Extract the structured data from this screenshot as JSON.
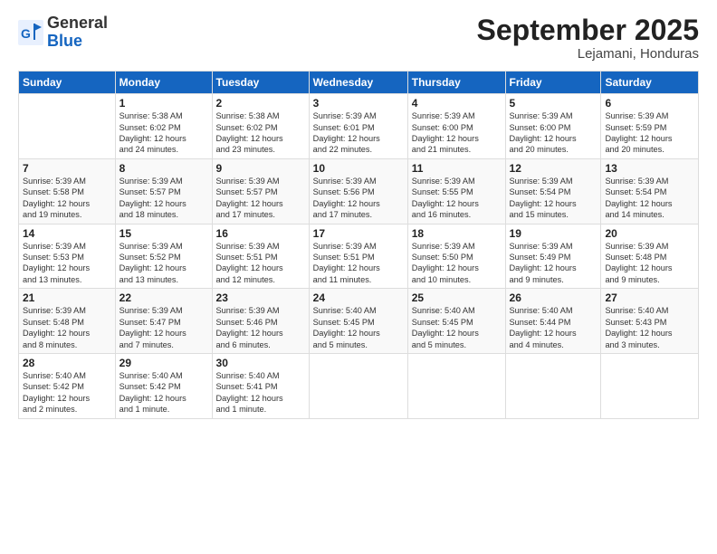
{
  "header": {
    "logo_general": "General",
    "logo_blue": "Blue",
    "month": "September 2025",
    "location": "Lejamani, Honduras"
  },
  "columns": [
    "Sunday",
    "Monday",
    "Tuesday",
    "Wednesday",
    "Thursday",
    "Friday",
    "Saturday"
  ],
  "weeks": [
    [
      {
        "day": "",
        "info": ""
      },
      {
        "day": "1",
        "info": "Sunrise: 5:38 AM\nSunset: 6:02 PM\nDaylight: 12 hours\nand 24 minutes."
      },
      {
        "day": "2",
        "info": "Sunrise: 5:38 AM\nSunset: 6:02 PM\nDaylight: 12 hours\nand 23 minutes."
      },
      {
        "day": "3",
        "info": "Sunrise: 5:39 AM\nSunset: 6:01 PM\nDaylight: 12 hours\nand 22 minutes."
      },
      {
        "day": "4",
        "info": "Sunrise: 5:39 AM\nSunset: 6:00 PM\nDaylight: 12 hours\nand 21 minutes."
      },
      {
        "day": "5",
        "info": "Sunrise: 5:39 AM\nSunset: 6:00 PM\nDaylight: 12 hours\nand 20 minutes."
      },
      {
        "day": "6",
        "info": "Sunrise: 5:39 AM\nSunset: 5:59 PM\nDaylight: 12 hours\nand 20 minutes."
      }
    ],
    [
      {
        "day": "7",
        "info": "Sunrise: 5:39 AM\nSunset: 5:58 PM\nDaylight: 12 hours\nand 19 minutes."
      },
      {
        "day": "8",
        "info": "Sunrise: 5:39 AM\nSunset: 5:57 PM\nDaylight: 12 hours\nand 18 minutes."
      },
      {
        "day": "9",
        "info": "Sunrise: 5:39 AM\nSunset: 5:57 PM\nDaylight: 12 hours\nand 17 minutes."
      },
      {
        "day": "10",
        "info": "Sunrise: 5:39 AM\nSunset: 5:56 PM\nDaylight: 12 hours\nand 17 minutes."
      },
      {
        "day": "11",
        "info": "Sunrise: 5:39 AM\nSunset: 5:55 PM\nDaylight: 12 hours\nand 16 minutes."
      },
      {
        "day": "12",
        "info": "Sunrise: 5:39 AM\nSunset: 5:54 PM\nDaylight: 12 hours\nand 15 minutes."
      },
      {
        "day": "13",
        "info": "Sunrise: 5:39 AM\nSunset: 5:54 PM\nDaylight: 12 hours\nand 14 minutes."
      }
    ],
    [
      {
        "day": "14",
        "info": "Sunrise: 5:39 AM\nSunset: 5:53 PM\nDaylight: 12 hours\nand 13 minutes."
      },
      {
        "day": "15",
        "info": "Sunrise: 5:39 AM\nSunset: 5:52 PM\nDaylight: 12 hours\nand 13 minutes."
      },
      {
        "day": "16",
        "info": "Sunrise: 5:39 AM\nSunset: 5:51 PM\nDaylight: 12 hours\nand 12 minutes."
      },
      {
        "day": "17",
        "info": "Sunrise: 5:39 AM\nSunset: 5:51 PM\nDaylight: 12 hours\nand 11 minutes."
      },
      {
        "day": "18",
        "info": "Sunrise: 5:39 AM\nSunset: 5:50 PM\nDaylight: 12 hours\nand 10 minutes."
      },
      {
        "day": "19",
        "info": "Sunrise: 5:39 AM\nSunset: 5:49 PM\nDaylight: 12 hours\nand 9 minutes."
      },
      {
        "day": "20",
        "info": "Sunrise: 5:39 AM\nSunset: 5:48 PM\nDaylight: 12 hours\nand 9 minutes."
      }
    ],
    [
      {
        "day": "21",
        "info": "Sunrise: 5:39 AM\nSunset: 5:48 PM\nDaylight: 12 hours\nand 8 minutes."
      },
      {
        "day": "22",
        "info": "Sunrise: 5:39 AM\nSunset: 5:47 PM\nDaylight: 12 hours\nand 7 minutes."
      },
      {
        "day": "23",
        "info": "Sunrise: 5:39 AM\nSunset: 5:46 PM\nDaylight: 12 hours\nand 6 minutes."
      },
      {
        "day": "24",
        "info": "Sunrise: 5:40 AM\nSunset: 5:45 PM\nDaylight: 12 hours\nand 5 minutes."
      },
      {
        "day": "25",
        "info": "Sunrise: 5:40 AM\nSunset: 5:45 PM\nDaylight: 12 hours\nand 5 minutes."
      },
      {
        "day": "26",
        "info": "Sunrise: 5:40 AM\nSunset: 5:44 PM\nDaylight: 12 hours\nand 4 minutes."
      },
      {
        "day": "27",
        "info": "Sunrise: 5:40 AM\nSunset: 5:43 PM\nDaylight: 12 hours\nand 3 minutes."
      }
    ],
    [
      {
        "day": "28",
        "info": "Sunrise: 5:40 AM\nSunset: 5:42 PM\nDaylight: 12 hours\nand 2 minutes."
      },
      {
        "day": "29",
        "info": "Sunrise: 5:40 AM\nSunset: 5:42 PM\nDaylight: 12 hours\nand 1 minute."
      },
      {
        "day": "30",
        "info": "Sunrise: 5:40 AM\nSunset: 5:41 PM\nDaylight: 12 hours\nand 1 minute."
      },
      {
        "day": "",
        "info": ""
      },
      {
        "day": "",
        "info": ""
      },
      {
        "day": "",
        "info": ""
      },
      {
        "day": "",
        "info": ""
      }
    ]
  ]
}
